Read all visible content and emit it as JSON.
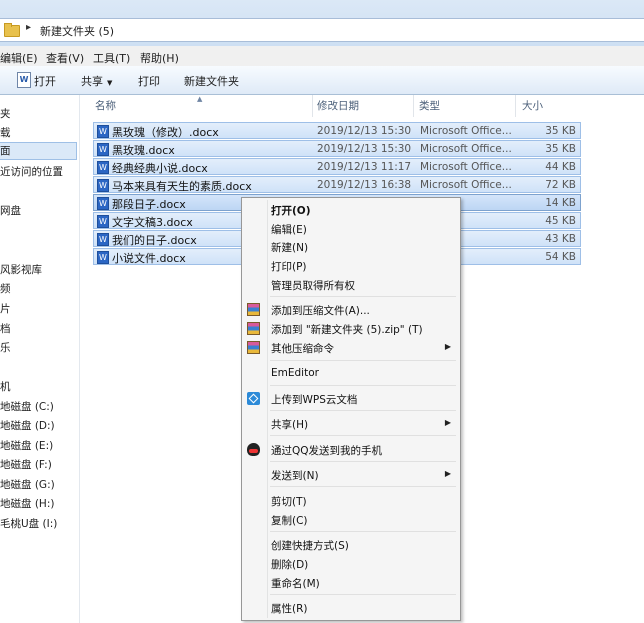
{
  "window": {
    "path": "新建文件夹 (5)"
  },
  "menubar": [
    "编辑(E)",
    "查看(V)",
    "工具(T)",
    "帮助(H)"
  ],
  "toolbar": {
    "open": "打开",
    "share": "共享",
    "print": "打印",
    "new_folder": "新建文件夹"
  },
  "nav": {
    "items": [
      "夹",
      "载",
      "面",
      "近访问的位置",
      "网盘",
      "风影视库",
      "频",
      "片",
      "档",
      "乐",
      "机",
      "地磁盘 (C:)",
      "地磁盘 (D:)",
      "地磁盘 (E:)",
      "地磁盘 (F:)",
      "地磁盘 (G:)",
      "地磁盘 (H:)",
      "毛桃U盘 (I:)"
    ]
  },
  "columns": {
    "name": "名称",
    "date": "修改日期",
    "type": "类型",
    "size": "大小"
  },
  "files": [
    {
      "name": "黑玫瑰（修改）.docx",
      "date": "2019/12/13 15:30",
      "type": "Microsoft Office...",
      "size": "35 KB"
    },
    {
      "name": "黑玫瑰.docx",
      "date": "2019/12/13 15:30",
      "type": "Microsoft Office...",
      "size": "35 KB"
    },
    {
      "name": "经典经典小说.docx",
      "date": "2019/12/13 11:17",
      "type": "Microsoft Office...",
      "size": "44 KB"
    },
    {
      "name": "马本来具有天生的素质.docx",
      "date": "2019/12/13 16:38",
      "type": "Microsoft Office...",
      "size": "72 KB"
    },
    {
      "name": "那段日子.docx",
      "date": "",
      "type": "",
      "size": "14 KB"
    },
    {
      "name": "文字文稿3.docx",
      "date": "",
      "type": "",
      "size": "45 KB"
    },
    {
      "name": "我们的日子.docx",
      "date": "",
      "type": "",
      "size": "43 KB"
    },
    {
      "name": "小说文件.docx",
      "date": "",
      "type": "",
      "size": "54 KB"
    }
  ],
  "context_menu": {
    "open": "打开(O)",
    "edit": "编辑(E)",
    "new": "新建(N)",
    "print": "打印(P)",
    "take_ownership": "管理员取得所有权",
    "add_archive": "添加到压缩文件(A)...",
    "add_zip": "添加到 \"新建文件夹 (5).zip\" (T)",
    "other_compress": "其他压缩命令",
    "emeditor": "EmEditor",
    "wps_upload": "上传到WPS云文档",
    "share": "共享(H)",
    "qq_send": "通过QQ发送到我的手机",
    "send_to": "发送到(N)",
    "cut": "剪切(T)",
    "copy": "复制(C)",
    "create_shortcut": "创建快捷方式(S)",
    "delete": "删除(D)",
    "rename": "重命名(M)",
    "properties": "属性(R)"
  }
}
